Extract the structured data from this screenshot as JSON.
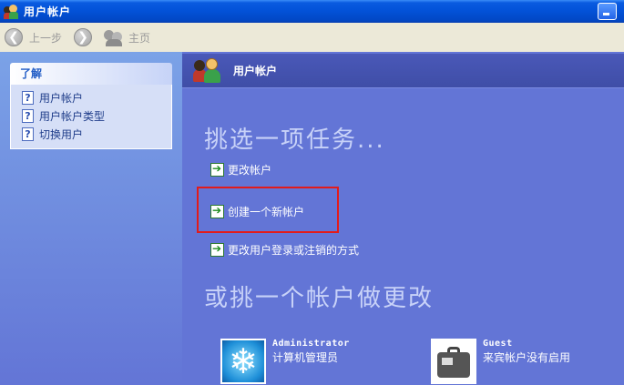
{
  "window": {
    "title": "用户帐户"
  },
  "toolbar": {
    "back_label": "上一步",
    "home_label": "主页"
  },
  "sidebar": {
    "panel_title": "了解",
    "links": [
      {
        "label": "用户帐户"
      },
      {
        "label": "用户帐户类型"
      },
      {
        "label": "切换用户"
      }
    ]
  },
  "main": {
    "header_title": "用户帐户",
    "task_heading": "挑选一项任务...",
    "tasks": [
      {
        "label": "更改帐户"
      },
      {
        "label": "创建一个新帐户"
      },
      {
        "label": "更改用户登录或注销的方式"
      }
    ],
    "accounts_heading": "或挑一个帐户做更改",
    "accounts": [
      {
        "name": "Administrator",
        "description": "计算机管理员"
      },
      {
        "name": "Guest",
        "description": "来宾帐户没有启用"
      }
    ]
  },
  "colors": {
    "titlebar": "#0352d9",
    "main_bg": "#6375d6",
    "highlight_box": "#e21b1b"
  }
}
